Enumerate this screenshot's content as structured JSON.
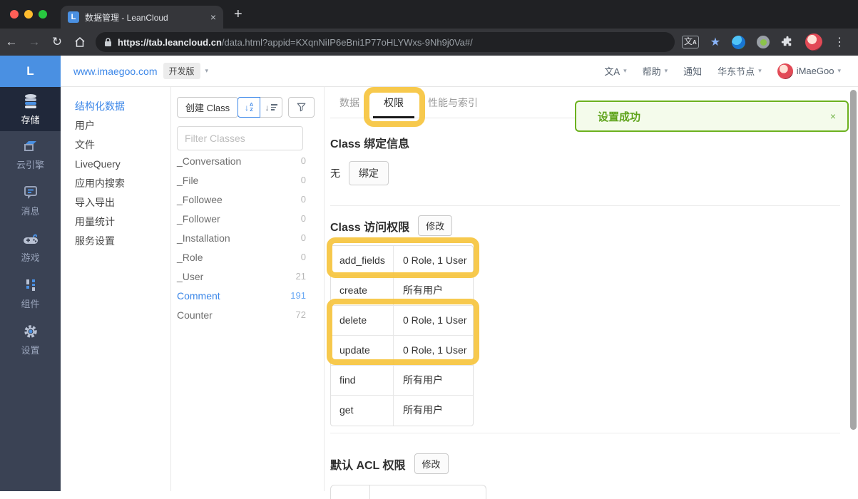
{
  "browser": {
    "tab_title": "数据管理 - LeanCloud",
    "tab_favicon": "L",
    "close_tab": "×",
    "new_tab": "+",
    "back": "←",
    "forward": "→",
    "reload": "↻",
    "menu": "⋮",
    "star": "★",
    "translate_main": "文",
    "translate_sub": "A",
    "url_host": "https://tab.leancloud.cn",
    "url_path": "/data.html?appid=KXqnNiIP6eBni1P77oHLYWxs-9Nh9j0Va#/"
  },
  "app_header": {
    "logo": "L",
    "domain": "www.imaegoo.com",
    "env_badge": "开发版",
    "caret": "▾",
    "nav": {
      "language": "文A",
      "help": "帮助",
      "notifications": "通知",
      "region": "华东节点",
      "username": "iMaeGoo"
    }
  },
  "sidebar": {
    "items": [
      {
        "label": "存储",
        "icon": "database-icon",
        "active": true
      },
      {
        "label": "云引擎",
        "icon": "cloud-engine-icon",
        "active": false
      },
      {
        "label": "消息",
        "icon": "message-icon",
        "active": false
      },
      {
        "label": "游戏",
        "icon": "gamepad-icon",
        "active": false
      },
      {
        "label": "组件",
        "icon": "components-icon",
        "active": false
      },
      {
        "label": "设置",
        "icon": "gear-icon",
        "active": false
      }
    ]
  },
  "submenu": {
    "items": [
      {
        "label": "结构化数据",
        "active": true
      },
      {
        "label": "用户",
        "active": false
      },
      {
        "label": "文件",
        "active": false
      },
      {
        "label": "LiveQuery",
        "active": false
      },
      {
        "label": "应用内搜索",
        "active": false
      },
      {
        "label": "导入导出",
        "active": false
      },
      {
        "label": "用量统计",
        "active": false
      },
      {
        "label": "服务设置",
        "active": false
      }
    ]
  },
  "class_panel": {
    "create_button": "创建 Class",
    "sort": {
      "arrow": "↓",
      "letter_a": "A",
      "letter_z": "Z"
    },
    "filter_placeholder": "Filter Classes",
    "classes": [
      {
        "name": "_Conversation",
        "count": "0"
      },
      {
        "name": "_File",
        "count": "0"
      },
      {
        "name": "_Followee",
        "count": "0"
      },
      {
        "name": "_Follower",
        "count": "0"
      },
      {
        "name": "_Installation",
        "count": "0"
      },
      {
        "name": "_Role",
        "count": "0"
      },
      {
        "name": "_User",
        "count": "21"
      },
      {
        "name": "Comment",
        "count": "191",
        "selected": true
      },
      {
        "name": "Counter",
        "count": "72"
      }
    ]
  },
  "main": {
    "tabs": [
      {
        "label": "数据",
        "active": false
      },
      {
        "label": "权限",
        "active": true
      },
      {
        "label": "性能与索引",
        "active": false
      }
    ],
    "toast": {
      "message": "设置成功",
      "close": "×"
    },
    "binding": {
      "title": "Class 绑定信息",
      "empty_label": "无",
      "bind_button": "绑定"
    },
    "acl": {
      "title": "Class 访问权限",
      "edit_button": "修改",
      "rows": [
        {
          "key": "add_fields",
          "value": "0 Role, 1 User"
        },
        {
          "key": "create",
          "value": "所有用户"
        },
        {
          "key": "delete",
          "value": "0 Role, 1 User"
        },
        {
          "key": "update",
          "value": "0 Role, 1 User"
        },
        {
          "key": "find",
          "value": "所有用户"
        },
        {
          "key": "get",
          "value": "所有用户"
        }
      ]
    },
    "default_acl": {
      "title": "默认 ACL 权限",
      "edit_button": "修改"
    }
  },
  "colors": {
    "accent_blue": "#4a90e2",
    "link_blue": "#3c87e8",
    "success_green": "#6cb11f",
    "highlight_yellow": "#f6c43e",
    "sidebar_bg": "#3a4254",
    "sidebar_selected_bg": "#20283a"
  }
}
